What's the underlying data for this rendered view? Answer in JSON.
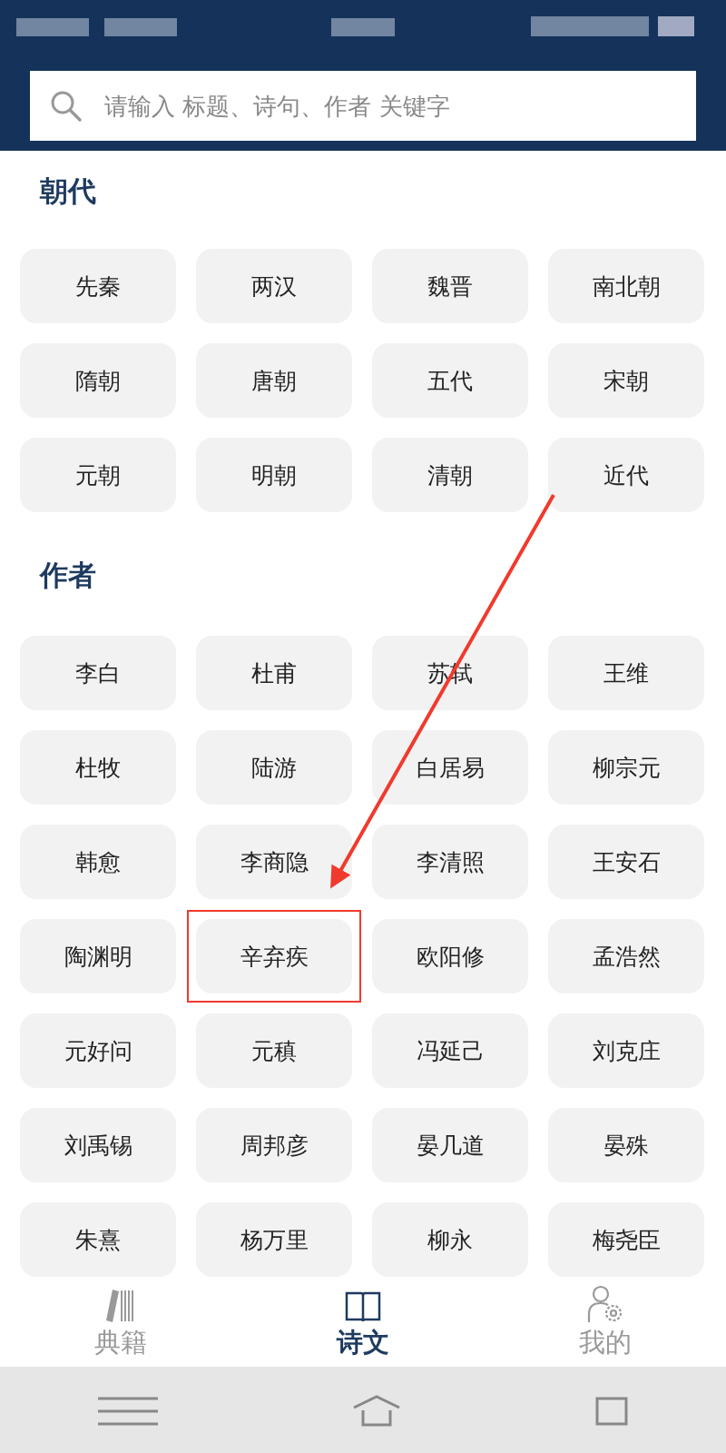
{
  "search": {
    "placeholder": "请输入 标题、诗句、作者 关键字"
  },
  "sections": [
    {
      "title": "朝代",
      "items": [
        {
          "label": "先秦",
          "highlighted": false
        },
        {
          "label": "两汉",
          "highlighted": false
        },
        {
          "label": "魏晋",
          "highlighted": false
        },
        {
          "label": "南北朝",
          "highlighted": false
        },
        {
          "label": "隋朝",
          "highlighted": false
        },
        {
          "label": "唐朝",
          "highlighted": false
        },
        {
          "label": "五代",
          "highlighted": false
        },
        {
          "label": "宋朝",
          "highlighted": false
        },
        {
          "label": "元朝",
          "highlighted": false
        },
        {
          "label": "明朝",
          "highlighted": false
        },
        {
          "label": "清朝",
          "highlighted": false
        },
        {
          "label": "近代",
          "highlighted": false
        }
      ]
    },
    {
      "title": "作者",
      "items": [
        {
          "label": "李白",
          "highlighted": false
        },
        {
          "label": "杜甫",
          "highlighted": false
        },
        {
          "label": "苏轼",
          "highlighted": false
        },
        {
          "label": "王维",
          "highlighted": false
        },
        {
          "label": "杜牧",
          "highlighted": false
        },
        {
          "label": "陆游",
          "highlighted": false
        },
        {
          "label": "白居易",
          "highlighted": false
        },
        {
          "label": "柳宗元",
          "highlighted": false
        },
        {
          "label": "韩愈",
          "highlighted": false
        },
        {
          "label": "李商隐",
          "highlighted": false
        },
        {
          "label": "李清照",
          "highlighted": false
        },
        {
          "label": "王安石",
          "highlighted": false
        },
        {
          "label": "陶渊明",
          "highlighted": false
        },
        {
          "label": "辛弃疾",
          "highlighted": true
        },
        {
          "label": "欧阳修",
          "highlighted": false
        },
        {
          "label": "孟浩然",
          "highlighted": false
        },
        {
          "label": "元好问",
          "highlighted": false
        },
        {
          "label": "元稹",
          "highlighted": false
        },
        {
          "label": "冯延己",
          "highlighted": false
        },
        {
          "label": "刘克庄",
          "highlighted": false
        },
        {
          "label": "刘禹锡",
          "highlighted": false
        },
        {
          "label": "周邦彦",
          "highlighted": false
        },
        {
          "label": "晏几道",
          "highlighted": false
        },
        {
          "label": "晏殊",
          "highlighted": false
        },
        {
          "label": "朱熹",
          "highlighted": false
        },
        {
          "label": "杨万里",
          "highlighted": false
        },
        {
          "label": "柳永",
          "highlighted": false
        },
        {
          "label": "梅尧臣",
          "highlighted": false
        }
      ]
    }
  ],
  "tabs": [
    {
      "label": "典籍",
      "kind": "books",
      "selected": false
    },
    {
      "label": "诗文",
      "kind": "book",
      "selected": true
    },
    {
      "label": "我的",
      "kind": "profile",
      "selected": false
    }
  ]
}
